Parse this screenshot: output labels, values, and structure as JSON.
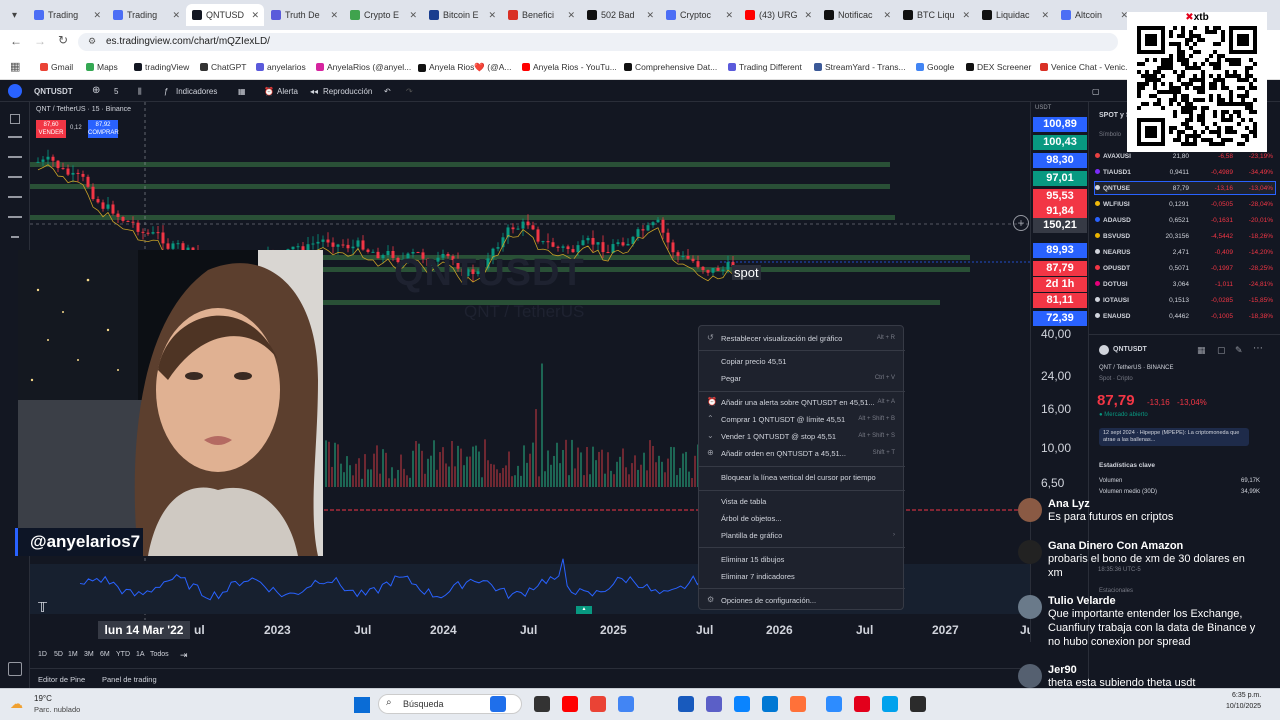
{
  "browser": {
    "tabs": [
      {
        "label": "Trading",
        "color": "#4c6ef5"
      },
      {
        "label": "Trading",
        "color": "#4c6ef5"
      },
      {
        "label": "QNTUSD",
        "color": "#131722",
        "active": true
      },
      {
        "label": "Truth De",
        "color": "#5a5adb"
      },
      {
        "label": "Crypto E",
        "color": "#3fa34d"
      },
      {
        "label": "Bitcoin E",
        "color": "#1a3e8f"
      },
      {
        "label": "Benefici",
        "color": "#d93025"
      },
      {
        "label": "502 Bad",
        "color": "#111111"
      },
      {
        "label": "Cryptoc",
        "color": "#4c6ef5"
      },
      {
        "label": "(43) URG",
        "color": "#ff0000"
      },
      {
        "label": "Notificac",
        "color": "#111111"
      },
      {
        "label": "BTC Liqu",
        "color": "#111111"
      },
      {
        "label": "Liquidac",
        "color": "#111111"
      },
      {
        "label": "Altcoin",
        "color": "#4c6ef5"
      }
    ],
    "url": "es.tradingview.com/chart/mQZIexLD/",
    "bookmarks": [
      {
        "label": "Gmail",
        "color": "#ea4335"
      },
      {
        "label": "Maps",
        "color": "#34a853"
      },
      {
        "label": "tradingView",
        "color": "#131722"
      },
      {
        "label": "ChatGPT",
        "color": "#333333"
      },
      {
        "label": "anyelarios",
        "color": "#5a5adb"
      },
      {
        "label": "AnyelaRios (@anyel...",
        "color": "#d6249f"
      },
      {
        "label": "Anyela Rios❤️ (@A...",
        "color": "#111111"
      },
      {
        "label": "Anyela Rios - YouTu...",
        "color": "#ff0000"
      },
      {
        "label": "Comprehensive Dat...",
        "color": "#111111"
      },
      {
        "label": "Trading Different",
        "color": "#5a5adb"
      },
      {
        "label": "StreamYard - Trans...",
        "color": "#3b5998"
      },
      {
        "label": "Google",
        "color": "#4285f4"
      },
      {
        "label": "DEX Screener",
        "color": "#111111"
      },
      {
        "label": "Venice Chat - Venic...",
        "color": "#d93025"
      }
    ]
  },
  "toolbar": {
    "symbol": "QNTUSDT",
    "interval": "5",
    "indicators": "Indicadores",
    "alert": "Alerta",
    "replay": "Reproducción"
  },
  "chart": {
    "legend": "QNT / TetherUS · 15 · Binance",
    "sell_price": "87,60",
    "sell_label": "VENDER",
    "spread": "0,12",
    "buy_price": "87,92",
    "buy_label": "COMPRAR",
    "watermark_symbol": "QNTUSDT",
    "watermark_name": "QNT / TetherUS",
    "spot_label": "spot",
    "cursor_date": "lun 14 Mar '22",
    "time_labels": [
      "ul",
      "2023",
      "Jul",
      "2024",
      "Jul",
      "2025",
      "Jul",
      "2026",
      "Jul",
      "2027",
      "Ju"
    ],
    "currency": "USDT",
    "price_labels": [
      {
        "value": "100,89",
        "color": "#2962ff"
      },
      {
        "value": "100,43",
        "color": "#089981"
      },
      {
        "value": "98,30",
        "color": "#2962ff"
      },
      {
        "value": "97,01",
        "color": "#089981"
      },
      {
        "value": "95,53",
        "color": "#f23645"
      },
      {
        "value": "91,84",
        "color": "#f23645"
      },
      {
        "value": "150,21",
        "color": "#363a45"
      },
      {
        "value": "89,93",
        "color": "#2962ff"
      },
      {
        "value": "87,79",
        "color": "#f23645"
      },
      {
        "value": "2d 1h",
        "color": "#f23645"
      },
      {
        "value": "81,11",
        "color": "#f23645"
      },
      {
        "value": "72,39",
        "color": "#2962ff"
      }
    ],
    "axis_labels": [
      "40,00",
      "24,00",
      "16,00",
      "10,00",
      "6,50"
    ],
    "ranges": [
      "1D",
      "5D",
      "1M",
      "3M",
      "6M",
      "YTD",
      "1A",
      "Todos"
    ],
    "bottom_tabs": [
      "Editor de Pine",
      "Panel de trading"
    ]
  },
  "context_menu": {
    "items": [
      {
        "label": "Restablecer visualización del gráfico",
        "shortcut": "Alt + R"
      },
      {
        "label": "Copiar precio 45,51",
        "shortcut": ""
      },
      {
        "label": "Pegar",
        "shortcut": "Ctrl + V"
      },
      {
        "label": "Añadir una alerta sobre QNTUSDT en 45,51...",
        "shortcut": "Alt + A"
      },
      {
        "label": "Comprar 1 QNTUSDT @ límite 45,51",
        "shortcut": "Alt + Shift + B"
      },
      {
        "label": "Vender 1 QNTUSDT @ stop 45,51",
        "shortcut": "Alt + Shift + S"
      },
      {
        "label": "Añadir orden en QNTUSDT a 45,51...",
        "shortcut": "Shift + T"
      },
      {
        "label": "Bloquear la línea vertical del cursor por tiempo",
        "shortcut": ""
      },
      {
        "label": "Vista de tabla",
        "shortcut": ""
      },
      {
        "label": "Árbol de objetos...",
        "shortcut": ""
      },
      {
        "label": "Plantilla de gráfico",
        "shortcut": "›"
      },
      {
        "label": "Eliminar 15 dibujos",
        "shortcut": ""
      },
      {
        "label": "Eliminar 7 indicadores",
        "shortcut": ""
      },
      {
        "label": "Opciones de configuración...",
        "shortcut": ""
      }
    ]
  },
  "watchlist": {
    "header": "SPOT y S",
    "column": "Símbolo",
    "rows": [
      {
        "sym": "AVAXUSI",
        "last": "21,80",
        "chg": "-6,58",
        "pct": "-23,19%",
        "color": "#e84142"
      },
      {
        "sym": "TIAUSD1",
        "last": "0,9411",
        "chg": "-0,4989",
        "pct": "-34,49%",
        "color": "#7b2bf9"
      },
      {
        "sym": "QNTUSE",
        "last": "87,79",
        "chg": "-13,16",
        "pct": "-13,04%",
        "color": "#d1d4dc"
      },
      {
        "sym": "WLFIUSI",
        "last": "0,1291",
        "chg": "-0,0505",
        "pct": "-28,04%",
        "color": "#f0b90b"
      },
      {
        "sym": "ADAUSD",
        "last": "0,6521",
        "chg": "-0,1631",
        "pct": "-20,01%",
        "color": "#2962ff"
      },
      {
        "sym": "BSVUSD",
        "last": "20,3156",
        "chg": "-4,5442",
        "pct": "-18,26%",
        "color": "#eab300"
      },
      {
        "sym": "NEARUS",
        "last": "2,471",
        "chg": "-0,409",
        "pct": "-14,20%",
        "color": "#d1d4dc"
      },
      {
        "sym": "OPUSDT",
        "last": "0,5071",
        "chg": "-0,1997",
        "pct": "-28,25%",
        "color": "#f23645"
      },
      {
        "sym": "DOTUSI",
        "last": "3,064",
        "chg": "-1,011",
        "pct": "-24,81%",
        "color": "#e6007a"
      },
      {
        "sym": "IOTAUSI",
        "last": "0,1513",
        "chg": "-0,0285",
        "pct": "-15,85%",
        "color": "#d1d4dc"
      },
      {
        "sym": "ENAUSD",
        "last": "0,4462",
        "chg": "-0,1005",
        "pct": "-18,38%",
        "color": "#d1d4dc"
      }
    ],
    "detail": {
      "symbol": "QNTUSDT",
      "name": "QNT / TetherUS",
      "exchange": "BINANCE",
      "type": "Spot · Cripto",
      "price": "87,79",
      "change": "-13,16",
      "change_pct": "-13,04%",
      "status": "Mercado abierto",
      "news": "12 sept 2024 · Hipeppe (MPEPE): La criptomoneda que atrae a las ballenas...",
      "stats_title": "Estadísticas clave",
      "volume_label": "Volumen",
      "volume_value": "69,17K",
      "avg_volume_label": "Volumen medio (30D)",
      "avg_volume_value": "34,99K",
      "seasonal": "Estacionales"
    }
  },
  "chat": [
    {
      "author": "Ana Lyz",
      "text": "Es para futuros en criptos",
      "avatar": "#8a5a44"
    },
    {
      "author": "Gana Dinero Con Amazon",
      "text": "probaris el bono de xm de 30 dolares en xm",
      "avatar": "#222222"
    },
    {
      "author": "Tulio Velarde",
      "text": "Que importante entender los Exchange, Cuanfiury trabaja con la data de Binance y no hubo conexion por spread",
      "avatar": "#6a7a8a"
    },
    {
      "author": "Jer90",
      "text": "theta esta subiendo theta usdt",
      "avatar": "#556070"
    }
  ],
  "stream": {
    "handle": "@anyelarios7",
    "brand": "xtb",
    "timestamp": "18:35:36 UTC-5"
  },
  "taskbar": {
    "weather_temp": "19°C",
    "weather_desc": "Parc. nublado",
    "search": "Búsqueda",
    "time": "6:35 p.m.",
    "date": "10/10/2025"
  }
}
